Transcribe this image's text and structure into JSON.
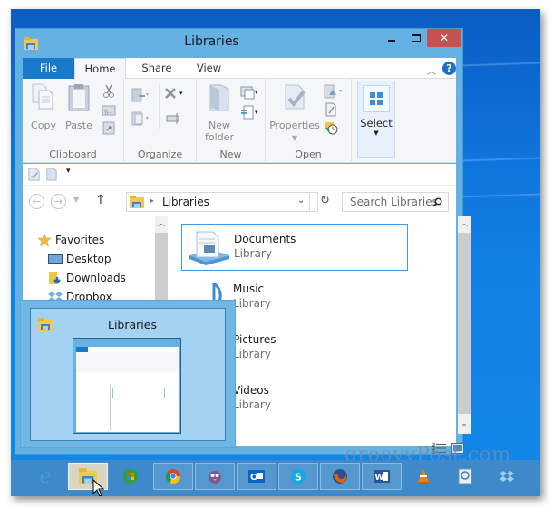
{
  "window": {
    "title": "Libraries",
    "controls": {
      "minimize": "minimize",
      "maximize": "maximize",
      "close": "✕"
    }
  },
  "ribbon": {
    "tabs": [
      {
        "label": "File",
        "active": false
      },
      {
        "label": "Home",
        "active": true
      },
      {
        "label": "Share",
        "active": false
      },
      {
        "label": "View",
        "active": false
      }
    ],
    "help": "?",
    "groups": {
      "clipboard": {
        "label": "Clipboard",
        "copy": "Copy",
        "paste": "Paste"
      },
      "organize": {
        "label": "Organize"
      },
      "new": {
        "label": "New",
        "new_folder_line1": "New",
        "new_folder_line2": "folder"
      },
      "open": {
        "label": "Open",
        "properties": "Properties"
      },
      "select": {
        "label": "Select"
      }
    }
  },
  "navigation": {
    "address": "Libraries",
    "search_placeholder": "Search Libraries"
  },
  "nav_pane": {
    "items": [
      {
        "label": "Favorites",
        "icon": "star-icon"
      },
      {
        "label": "Desktop",
        "icon": "desktop-icon"
      },
      {
        "label": "Downloads",
        "icon": "downloads-icon"
      },
      {
        "label": "Dropbox",
        "icon": "dropbox-icon"
      }
    ]
  },
  "libraries": [
    {
      "name": "Documents",
      "type": "Library",
      "selected": true
    },
    {
      "name": "Music",
      "type": "Library",
      "selected": false
    },
    {
      "name": "Pictures",
      "type": "Library",
      "selected": false
    },
    {
      "name": "Videos",
      "type": "Library",
      "selected": false
    }
  ],
  "thumbnail": {
    "title": "Libraries"
  },
  "taskbar": {
    "items": [
      {
        "name": "internet-explorer"
      },
      {
        "name": "file-explorer",
        "active": true
      },
      {
        "name": "windows-media-center"
      },
      {
        "name": "chrome"
      },
      {
        "name": "pidgin"
      },
      {
        "name": "outlook"
      },
      {
        "name": "skype"
      },
      {
        "name": "firefox"
      },
      {
        "name": "word"
      },
      {
        "name": "vlc"
      },
      {
        "name": "search-viewer"
      },
      {
        "name": "dropbox"
      }
    ]
  },
  "watermark": "groovyPost.com"
}
